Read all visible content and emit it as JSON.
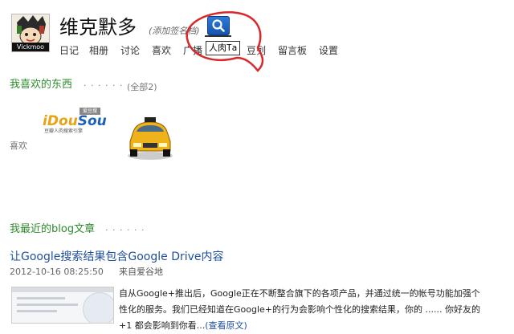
{
  "profile": {
    "avatar_caption": "Vickmoo",
    "name": "维克默多",
    "signature_hint": "(添加签名档)"
  },
  "search": {
    "tooltip": "人肉Ta"
  },
  "nav": {
    "items": [
      "日记",
      "相册",
      "讨论",
      "喜欢",
      "广播",
      "豆列",
      "留言板",
      "设置"
    ]
  },
  "likes": {
    "title": "我喜欢的东西",
    "dots": "· · · · · ·",
    "all_link": "(全部2)",
    "side_label": "喜欢",
    "items": [
      {
        "logo_word_a": "iDou",
        "logo_word_b": "Sou",
        "logo_badge": "爱豆搜",
        "logo_tagline": "豆瓣人肉搜索引擎"
      },
      {
        "icon": "car-icon"
      }
    ]
  },
  "blog": {
    "title": "我最近的blog文章",
    "dots": "· · · · · ·",
    "post": {
      "title": "让Google搜索结果包含Google Drive内容",
      "datetime": "2012-10-16 08:25:50",
      "source": "来自爱谷地",
      "body": "自从Google+推出后，Google正在不断整合旗下的各项产品，并通过统一的帐号功能加强个性化的服务。我们已经知道在Google+的行为会影响个性化的搜索结果，你的 ...... 你好友的+1 都会影响到你看...",
      "more": "(查看原文)"
    }
  },
  "colors": {
    "green": "#2d8b2d",
    "link": "#1f4f9e",
    "search_blue": "#1e63c2",
    "annotation_red": "#d9282a"
  }
}
